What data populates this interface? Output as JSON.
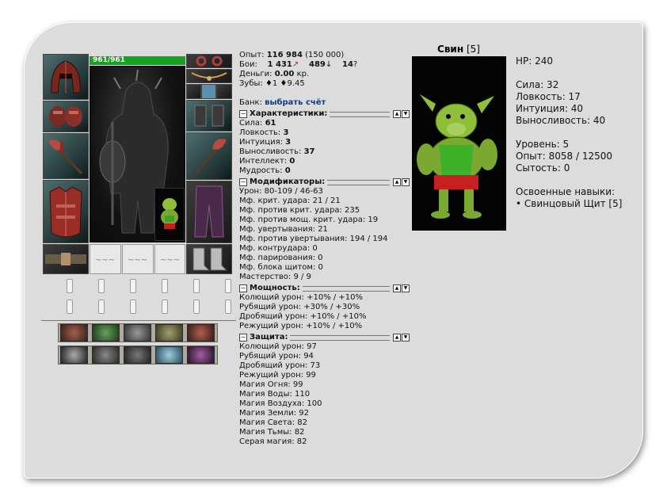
{
  "character": {
    "hp_text": "961/961",
    "hp_percent": 100
  },
  "equipment_icons": {
    "left": [
      "helmet-icon",
      "gloves-icon",
      "axe-icon",
      "breastplate-icon",
      "belt-icon"
    ],
    "right": [
      "ring-icon",
      "amulet-icon",
      "elixir-icon",
      "gauntlets-icon",
      "axe-icon",
      "leggings-icon",
      "boots-icon"
    ],
    "scrolls": [
      "scroll-icon",
      "scroll-icon",
      "scroll-icon"
    ]
  },
  "stats": {
    "exp_label": "Опыт:",
    "exp_value": "116 984",
    "exp_next": "(150 000)",
    "battles_label": "Бои:",
    "battles_wins": "1 431",
    "battles_losses": "489",
    "battles_draws": "14",
    "money_label": "Деньги:",
    "money_value": "0.00",
    "money_unit": "кр.",
    "teeth_label": "Зубы:",
    "teeth_a": "1",
    "teeth_b": "9.45",
    "bank_label": "Банк:",
    "bank_link": "выбрать счёт"
  },
  "sections": {
    "characteristics": {
      "title": "Характеристики:",
      "toggle": "−",
      "rows": [
        {
          "label": "Сила:",
          "value": "61"
        },
        {
          "label": "Ловкость:",
          "value": "3"
        },
        {
          "label": "Интуиция:",
          "value": "3"
        },
        {
          "label": "Выносливость:",
          "value": "37"
        },
        {
          "label": "Интеллект:",
          "value": "0"
        },
        {
          "label": "Мудрость:",
          "value": "0"
        }
      ]
    },
    "modifiers": {
      "title": "Модификаторы:",
      "toggle": "−",
      "rows": [
        "Урон: 80-109 / 46-63",
        "Мф. крит. удара: 21 / 21",
        "Мф. против крит. удара: 235",
        "Мф. против мощ. крит. удара: 19",
        "Мф. увертывания: 21",
        "Мф. против увертывания: 194 / 194",
        "Мф. контрудара: 0",
        "Мф. парирования: 0",
        "Мф. блока щитом: 0",
        "Мастерство: 9 / 9"
      ]
    },
    "power": {
      "title": "Мощность:",
      "toggle": "−",
      "rows": [
        "Колющий урон: +10% / +10%",
        "Рубящий урон: +30% / +30%",
        "Дробящий урон: +10% / +10%",
        "Режущий урон: +10% / +10%"
      ]
    },
    "defense": {
      "title": "Защита:",
      "toggle": "−",
      "rows": [
        "Колющий урон: 97",
        "Рубящий урон: 94",
        "Дробящий урон: 73",
        "Режущий урон: 99",
        "Магия Огня: 99",
        "Магия Воды: 110",
        "Магия Воздуха: 100",
        "Магия Земли: 92",
        "Магия Света: 82",
        "Магия Тьмы: 82",
        "Серая магия: 82"
      ]
    }
  },
  "pet": {
    "name": "Свин",
    "level": "[5]",
    "hp": "HP: 240",
    "strength": "Сила: 32",
    "agility": "Ловкость: 17",
    "intuition": "Интуиция: 40",
    "endurance": "Выносливость: 40",
    "level_line": "Уровень: 5",
    "exp_line": "Опыт: 8058 / 12500",
    "satiety_line": "Сытость: 0",
    "skills_title": "Освоенные навыки:",
    "skill_1": "• Свинцовый Щит [5]"
  },
  "colors": {
    "hp_bar": "#18a31f",
    "panel_bg": "#dcdcdc",
    "link": "#0a3c8c"
  }
}
